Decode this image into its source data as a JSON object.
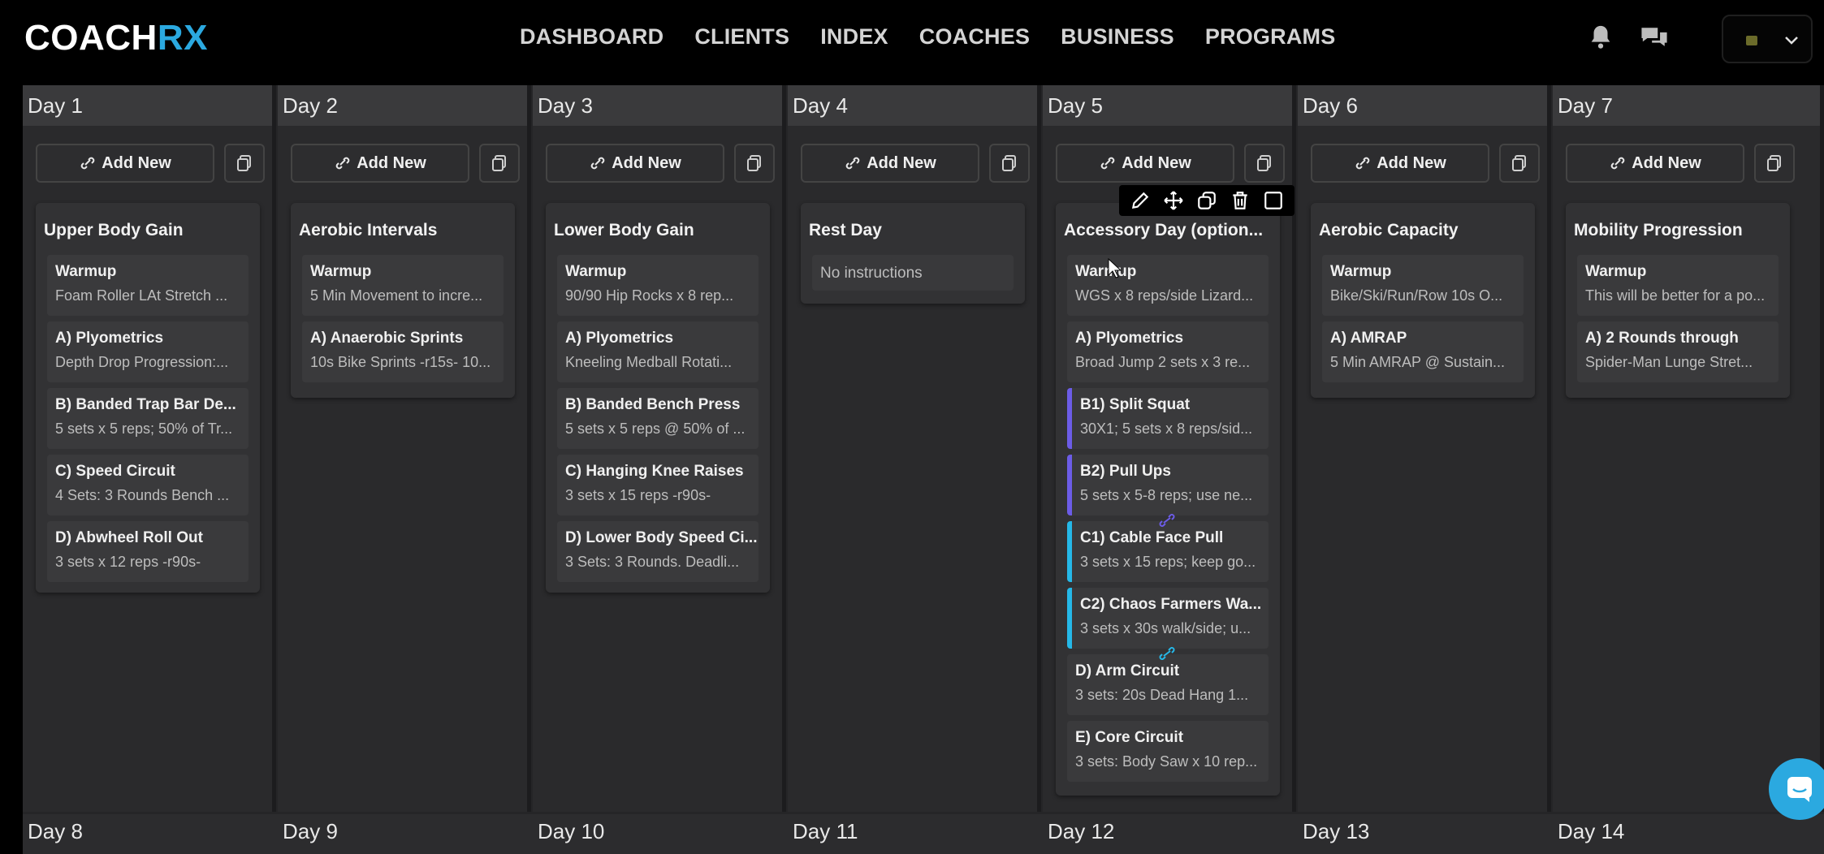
{
  "brand": {
    "logo_main": "COACH",
    "logo_accent": "RX",
    "accent_color": "#2ba9e0"
  },
  "nav": [
    "DASHBOARD",
    "CLIENTS",
    "INDEX",
    "COACHES",
    "BUSINESS",
    "PROGRAMS"
  ],
  "icons": {
    "notifications": "bell-icon",
    "messages": "chat-icon",
    "account": "chevron-down-icon",
    "copy": "copy-icon",
    "link": "link-icon"
  },
  "add_new_label": "Add New",
  "toolbar_icons": [
    "pencil-icon",
    "move-icon",
    "duplicate-icon",
    "trash-icon",
    "checkbox-icon"
  ],
  "days": [
    {
      "label": "Day 1",
      "workout": "Upper Body Gain",
      "exercises": [
        {
          "name": "Warmup",
          "desc": "Foam Roller LAt Stretch ..."
        },
        {
          "name": "A) Plyometrics",
          "desc": "Depth Drop Progression:..."
        },
        {
          "name": "B) Banded Trap Bar De...",
          "desc": "5 sets x 5 reps; 50% of Tr..."
        },
        {
          "name": "C) Speed Circuit",
          "desc": "4 Sets: 3 Rounds Bench ..."
        },
        {
          "name": "D) Abwheel Roll Out",
          "desc": "3 sets x 12 reps -r90s-"
        }
      ]
    },
    {
      "label": "Day 2",
      "workout": "Aerobic Intervals",
      "exercises": [
        {
          "name": "Warmup",
          "desc": "5 Min Movement to incre..."
        },
        {
          "name": "A) Anaerobic Sprints",
          "desc": "10s Bike Sprints -r15s- 10..."
        }
      ]
    },
    {
      "label": "Day 3",
      "workout": "Lower Body Gain",
      "exercises": [
        {
          "name": "Warmup",
          "desc": "90/90 Hip Rocks x 8 rep..."
        },
        {
          "name": "A) Plyometrics",
          "desc": "Kneeling Medball Rotati..."
        },
        {
          "name": "B) Banded Bench Press",
          "desc": "5 sets x 5 reps @ 50% of ..."
        },
        {
          "name": "C) Hanging Knee Raises",
          "desc": "3 sets x 15 reps -r90s-"
        },
        {
          "name": "D) Lower Body Speed Ci...",
          "desc": "3 Sets: 3 Rounds. Deadli..."
        }
      ]
    },
    {
      "label": "Day 4",
      "workout": "Rest Day",
      "no_instructions": "No instructions",
      "exercises": []
    },
    {
      "label": "Day 5",
      "workout": "Accessory Day (option...",
      "exercises": [
        {
          "name": "Warmup",
          "desc": "WGS x 8 reps/side Lizard..."
        },
        {
          "name": "A) Plyometrics",
          "desc": "Broad Jump 2 sets x 3 re..."
        },
        {
          "name": "B1) Split Squat",
          "desc": "30X1; 5 sets x 8 reps/sid..."
        },
        {
          "name": "B2) Pull Ups",
          "desc": "5 sets x 5-8 reps; use ne..."
        },
        {
          "name": "C1) Cable Face Pull",
          "desc": "3 sets x 15 reps; keep go..."
        },
        {
          "name": "C2) Chaos Farmers Wa...",
          "desc": "3 sets x 30s walk/side; u..."
        },
        {
          "name": "D) Arm Circuit",
          "desc": "3 sets: 20s Dead Hang 1..."
        },
        {
          "name": "E) Core Circuit",
          "desc": "3 sets: Body Saw x 10 rep..."
        }
      ]
    },
    {
      "label": "Day 6",
      "workout": "Aerobic Capacity",
      "exercises": [
        {
          "name": "Warmup",
          "desc": "Bike/Ski/Run/Row 10s O..."
        },
        {
          "name": "A) AMRAP",
          "desc": "5 Min AMRAP @ Sustain..."
        }
      ]
    },
    {
      "label": "Day 7",
      "workout": "Mobility Progression",
      "exercises": [
        {
          "name": "Warmup",
          "desc": "This will be better for a po..."
        },
        {
          "name": "A) 2 Rounds through",
          "desc": "Spider-Man Lunge Stret..."
        }
      ]
    }
  ],
  "next_week": [
    "Day 8",
    "Day 9",
    "Day 10",
    "Day 11",
    "Day 12",
    "Day 13",
    "Day 14"
  ],
  "superset_colors": {
    "B": "#6c5ce7",
    "C": "#25b8e8"
  }
}
